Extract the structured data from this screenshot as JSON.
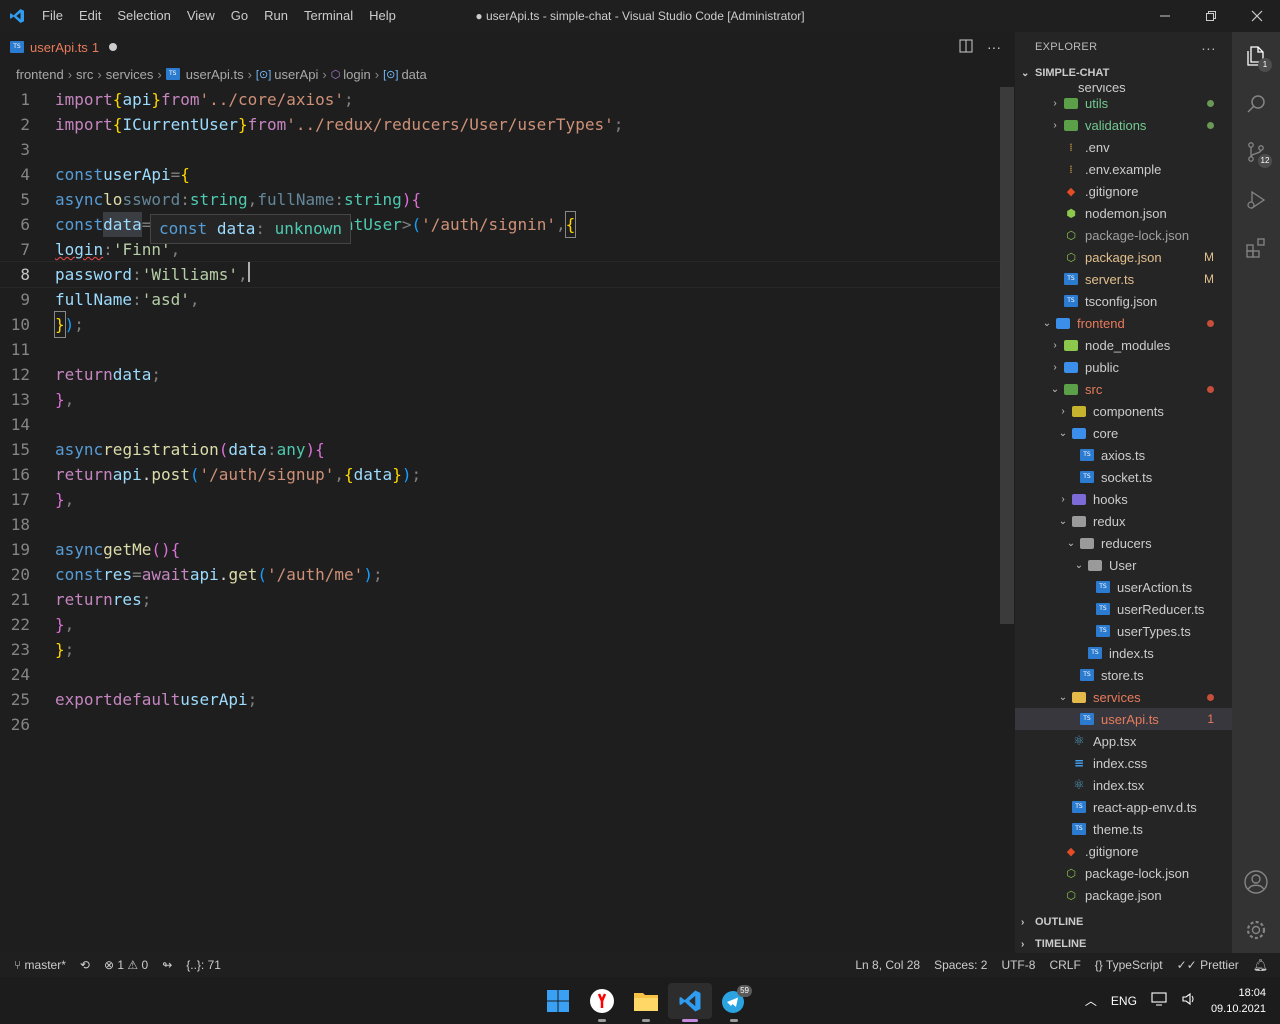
{
  "window": {
    "title": "● userApi.ts - simple-chat - Visual Studio Code [Administrator]",
    "menu": [
      "File",
      "Edit",
      "Selection",
      "View",
      "Go",
      "Run",
      "Terminal",
      "Help"
    ]
  },
  "tab": {
    "file": "userApi.ts",
    "problems": "1"
  },
  "breadcrumb": [
    "frontend",
    "src",
    "services",
    "userApi.ts",
    "userApi",
    "login",
    "data"
  ],
  "hover": {
    "kw": "const",
    "name": "data",
    "colon": ":",
    "type": "unknown"
  },
  "code": {
    "l1": [
      "import",
      "{",
      "api",
      "}",
      "from",
      "'../core/axios'",
      ";"
    ],
    "l2": [
      "import",
      "{",
      "ICurrentUser",
      "}",
      "from",
      "'../redux/reducers/User/userTypes'",
      ";"
    ],
    "l4": [
      "const",
      "userApi",
      "=",
      "{"
    ],
    "l5": [
      "async",
      "lo",
      "ssword",
      ":",
      "string",
      ",",
      "fullName",
      ":",
      "string",
      ")",
      "{"
    ],
    "l6": [
      "const",
      "data",
      "=",
      "await",
      "api",
      ".",
      "post",
      "<",
      "ICurrentUser",
      ">",
      "(",
      "'/auth/signin'",
      ",",
      "{"
    ],
    "l7": [
      "login",
      ":",
      "'Finn'",
      ","
    ],
    "l8": [
      "password",
      ":",
      "'Williams'",
      ","
    ],
    "l9": [
      "fullName",
      ":",
      "'asd'",
      ","
    ],
    "l10": [
      "}",
      ")",
      ";"
    ],
    "l12": [
      "return",
      "data",
      ";"
    ],
    "l13": [
      "}",
      ","
    ],
    "l15": [
      "async",
      "registration",
      "(",
      "data",
      ":",
      "any",
      ")",
      "{"
    ],
    "l16": [
      "return",
      "api",
      ".",
      "post",
      "(",
      "'/auth/signup'",
      ",",
      "{",
      "data",
      "}",
      ")",
      ";"
    ],
    "l17": [
      "}",
      ","
    ],
    "l19": [
      "async",
      "getMe",
      "()",
      "{"
    ],
    "l20": [
      "const",
      "res",
      "=",
      "await",
      "api",
      ".",
      "get",
      "(",
      "'/auth/me'",
      ")",
      ";"
    ],
    "l21": [
      "return",
      "res",
      ";"
    ],
    "l22": [
      "}",
      ","
    ],
    "l23": [
      "}",
      ";"
    ],
    "l25": [
      "export",
      "default",
      "userApi",
      ";"
    ]
  },
  "line_numbers": [
    "1",
    "2",
    "3",
    "4",
    "5",
    "6",
    "7",
    "8",
    "9",
    "10",
    "11",
    "12",
    "13",
    "14",
    "15",
    "16",
    "17",
    "18",
    "19",
    "20",
    "21",
    "22",
    "23",
    "24",
    "25",
    "26"
  ],
  "explorer": {
    "header": "EXPLORER",
    "project": "SIMPLE-CHAT",
    "partial_top": "services",
    "items": [
      {
        "label": "utils",
        "indent": 1,
        "kind": "folder",
        "chev": "›",
        "color": "green",
        "dot": "#6a9955",
        "ico": "#5b9f48"
      },
      {
        "label": "validations",
        "indent": 1,
        "kind": "folder",
        "chev": "›",
        "color": "green",
        "dot": "#6a9955",
        "ico": "#5b9f48"
      },
      {
        "label": ".env",
        "indent": 1,
        "kind": "file",
        "chev": "",
        "color": "plain",
        "ico": "#d7a148",
        "glyph": "⁞"
      },
      {
        "label": ".env.example",
        "indent": 1,
        "kind": "file",
        "chev": "",
        "color": "plain",
        "ico": "#d7a148",
        "glyph": "⁞"
      },
      {
        "label": ".gitignore",
        "indent": 1,
        "kind": "file",
        "chev": "",
        "color": "plain",
        "ico": "#e44d26",
        "glyph": "◆"
      },
      {
        "label": "nodemon.json",
        "indent": 1,
        "kind": "file",
        "chev": "",
        "color": "plain",
        "ico": "#8cc84b",
        "glyph": "⬢"
      },
      {
        "label": "package-lock.json",
        "indent": 1,
        "kind": "file",
        "chev": "",
        "color": "dim",
        "ico": "#8cc84b",
        "glyph": "⬡"
      },
      {
        "label": "package.json",
        "indent": 1,
        "kind": "file",
        "chev": "",
        "color": "yellow",
        "badge": "M",
        "ico": "#8cc84b",
        "glyph": "⬡"
      },
      {
        "label": "server.ts",
        "indent": 1,
        "kind": "ts",
        "chev": "",
        "color": "yellow",
        "badge": "M"
      },
      {
        "label": "tsconfig.json",
        "indent": 1,
        "kind": "ts",
        "chev": "",
        "color": "plain"
      },
      {
        "label": "frontend",
        "indent": 0,
        "kind": "folder",
        "chev": "⌄",
        "color": "orange",
        "dot": "#c74e39",
        "ico": "#3b8eea"
      },
      {
        "label": "node_modules",
        "indent": 1,
        "kind": "folder",
        "chev": "›",
        "color": "plain",
        "ico": "#8cc84b"
      },
      {
        "label": "public",
        "indent": 1,
        "kind": "folder",
        "chev": "›",
        "color": "plain",
        "ico": "#3b8eea"
      },
      {
        "label": "src",
        "indent": 1,
        "kind": "folder",
        "chev": "⌄",
        "color": "orange",
        "dot": "#c74e39",
        "ico": "#5b9f48"
      },
      {
        "label": "components",
        "indent": 2,
        "kind": "folder",
        "chev": "›",
        "color": "plain",
        "ico": "#c6b32d"
      },
      {
        "label": "core",
        "indent": 2,
        "kind": "folder",
        "chev": "⌄",
        "color": "plain",
        "ico": "#3b8eea"
      },
      {
        "label": "axios.ts",
        "indent": 3,
        "kind": "ts",
        "chev": "",
        "color": "plain"
      },
      {
        "label": "socket.ts",
        "indent": 3,
        "kind": "ts",
        "chev": "",
        "color": "plain"
      },
      {
        "label": "hooks",
        "indent": 2,
        "kind": "folder",
        "chev": "›",
        "color": "plain",
        "ico": "#7c6ad7"
      },
      {
        "label": "redux",
        "indent": 2,
        "kind": "folder",
        "chev": "⌄",
        "color": "plain",
        "ico": "#9a9a9a"
      },
      {
        "label": "reducers",
        "indent": 3,
        "kind": "folder",
        "chev": "⌄",
        "color": "plain",
        "ico": "#9a9a9a"
      },
      {
        "label": "User",
        "indent": 4,
        "kind": "folder",
        "chev": "⌄",
        "color": "plain",
        "ico": "#9a9a9a"
      },
      {
        "label": "userAction.ts",
        "indent": 5,
        "kind": "ts",
        "chev": "",
        "color": "plain"
      },
      {
        "label": "userReducer.ts",
        "indent": 5,
        "kind": "ts",
        "chev": "",
        "color": "plain"
      },
      {
        "label": "userTypes.ts",
        "indent": 5,
        "kind": "ts",
        "chev": "",
        "color": "plain"
      },
      {
        "label": "index.ts",
        "indent": 4,
        "kind": "ts",
        "chev": "",
        "color": "plain"
      },
      {
        "label": "store.ts",
        "indent": 3,
        "kind": "ts",
        "chev": "",
        "color": "plain"
      },
      {
        "label": "services",
        "indent": 2,
        "kind": "folder",
        "chev": "⌄",
        "color": "orange",
        "dot": "#c74e39",
        "ico": "#e5b94a"
      },
      {
        "label": "userApi.ts",
        "indent": 3,
        "kind": "ts",
        "chev": "",
        "color": "orange",
        "badge": "1",
        "selected": true
      },
      {
        "label": "App.tsx",
        "indent": 2,
        "kind": "react",
        "chev": "",
        "color": "plain"
      },
      {
        "label": "index.css",
        "indent": 2,
        "kind": "css",
        "chev": "",
        "color": "plain"
      },
      {
        "label": "index.tsx",
        "indent": 2,
        "kind": "react",
        "chev": "",
        "color": "plain"
      },
      {
        "label": "react-app-env.d.ts",
        "indent": 2,
        "kind": "ts",
        "chev": "",
        "color": "plain"
      },
      {
        "label": "theme.ts",
        "indent": 2,
        "kind": "ts",
        "chev": "",
        "color": "plain"
      },
      {
        "label": ".gitignore",
        "indent": 1,
        "kind": "file",
        "chev": "",
        "color": "plain",
        "ico": "#e44d26",
        "glyph": "◆"
      },
      {
        "label": "package-lock.json",
        "indent": 1,
        "kind": "file",
        "chev": "",
        "color": "plain",
        "ico": "#8cc84b",
        "glyph": "⬡"
      },
      {
        "label": "package.json",
        "indent": 1,
        "kind": "file",
        "chev": "",
        "color": "plain",
        "ico": "#8cc84b",
        "glyph": "⬡"
      }
    ],
    "outline": "OUTLINE",
    "timeline": "TIMELINE"
  },
  "activity_badges": {
    "explorer": "1",
    "scm": "12"
  },
  "status": {
    "branch": "master*",
    "errors": "1",
    "warnings": "0",
    "json": "{..}: 71",
    "position": "Ln 8, Col 28",
    "spaces": "Spaces: 2",
    "encoding": "UTF-8",
    "eol": "CRLF",
    "language": "TypeScript",
    "formatter": "Prettier"
  },
  "taskbar": {
    "lang": "ENG",
    "time": "18:04",
    "date": "09.10.2021",
    "telegram_badge": "59"
  },
  "colors": {
    "accent": "#007acc",
    "ts": "#2b7bd0",
    "modified": "#e2c08d",
    "error": "#e77b5c"
  }
}
